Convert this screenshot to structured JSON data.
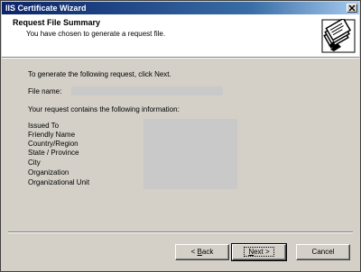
{
  "window": {
    "title": "IIS Certificate Wizard"
  },
  "header": {
    "title": "Request File Summary",
    "subtitle": "You have chosen to generate a request file."
  },
  "content": {
    "instruction": "To generate the following request, click Next.",
    "file_name_label": "File name:",
    "info_intro": "Your request contains the following information:",
    "fields": [
      "Issued To",
      "Friendly Name",
      "Country/Region",
      "State / Province",
      "City",
      "Organization",
      "Organizational Unit"
    ]
  },
  "buttons": {
    "back_prefix": "< ",
    "back_mnemonic": "B",
    "back_rest": "ack",
    "next_mnemonic": "N",
    "next_rest": "ext >",
    "cancel": "Cancel"
  }
}
